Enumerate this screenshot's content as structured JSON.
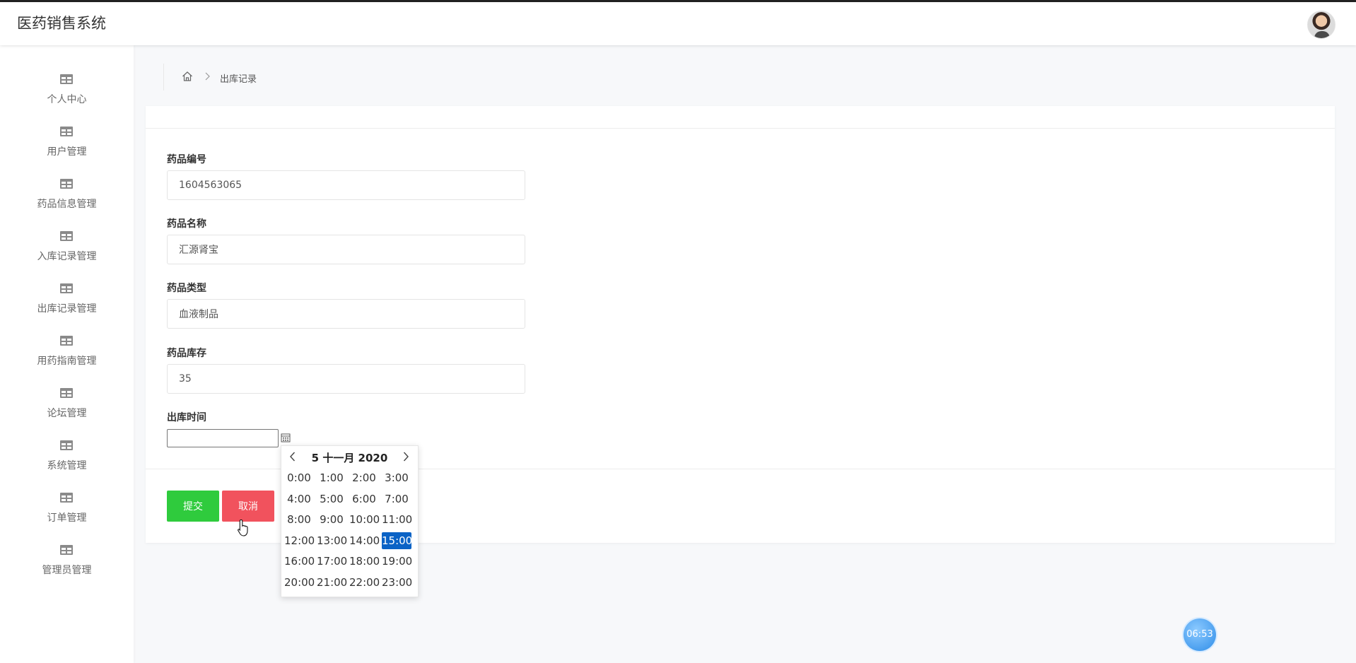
{
  "header": {
    "app_title": "医药销售系统"
  },
  "sidebar": {
    "items": [
      {
        "label": "个人中心"
      },
      {
        "label": "用户管理"
      },
      {
        "label": "药品信息管理"
      },
      {
        "label": "入库记录管理"
      },
      {
        "label": "出库记录管理"
      },
      {
        "label": "用药指南管理"
      },
      {
        "label": "论坛管理"
      },
      {
        "label": "系统管理"
      },
      {
        "label": "订单管理"
      },
      {
        "label": "管理员管理"
      }
    ]
  },
  "breadcrumb": {
    "current": "出库记录"
  },
  "form": {
    "fields": [
      {
        "label": "药品编号",
        "value": "1604563065"
      },
      {
        "label": "药品名称",
        "value": "汇源肾宝"
      },
      {
        "label": "药品类型",
        "value": "血液制品"
      },
      {
        "label": "药品库存",
        "value": "35"
      }
    ],
    "date_field": {
      "label": "出库时间",
      "value": ""
    },
    "submit_label": "提交",
    "cancel_label": "取消"
  },
  "datepicker": {
    "title": "5 十一月 2020",
    "hours": [
      "0:00",
      "1:00",
      "2:00",
      "3:00",
      "4:00",
      "5:00",
      "6:00",
      "7:00",
      "8:00",
      "9:00",
      "10:00",
      "11:00",
      "12:00",
      "13:00",
      "14:00",
      "15:00",
      "16:00",
      "17:00",
      "18:00",
      "19:00",
      "20:00",
      "21:00",
      "22:00",
      "23:00"
    ],
    "selected": "15:00"
  },
  "timer": {
    "text": "06:53"
  },
  "icons": {
    "menu": "table-icon",
    "home": "home-icon",
    "calendar": "calendar-icon"
  },
  "colors": {
    "submit": "#2fcb3d",
    "cancel": "#f1525d",
    "selected": "#0b63c6"
  }
}
